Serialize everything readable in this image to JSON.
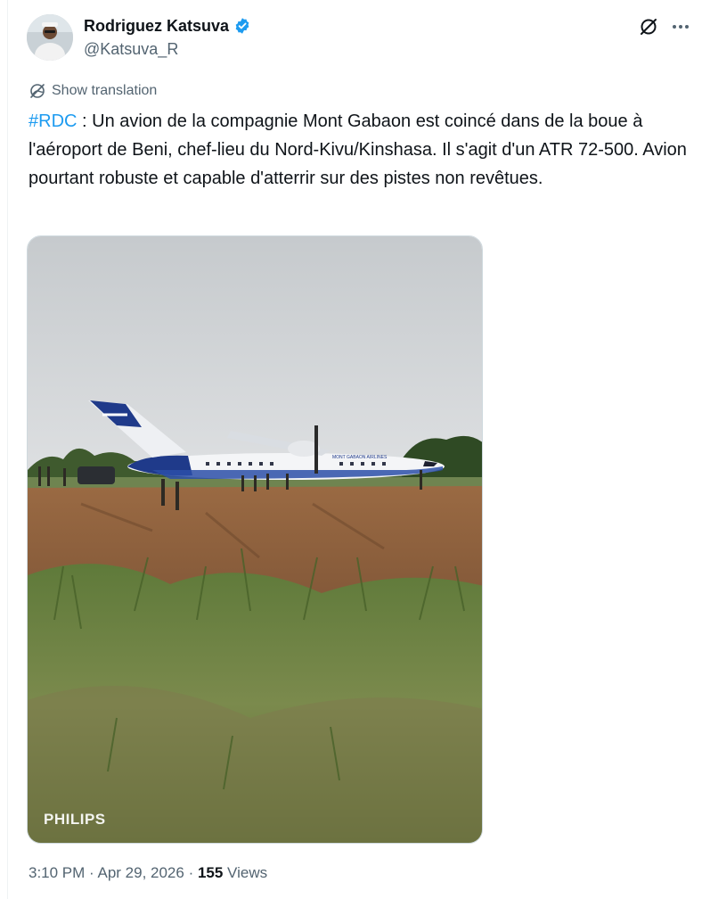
{
  "author": {
    "display_name": "Rodriguez Katsuva",
    "handle": "@Katsuva_R"
  },
  "translate_label": "Show translation",
  "tweet": {
    "hashtag": "#RDC",
    "text": " : Un avion de la compagnie Mont Gabaon est coincé dans de la boue à l'aéroport de Beni, chef-lieu du Nord-Kivu/Kinshasa. Il s'agit d'un ATR 72-500. Avion pourtant robuste et capable d'atterrir sur des pistes non revêtues."
  },
  "media": {
    "aircraft_livery": "MONT GABAON AIRLINES",
    "watermark": "PHILIPS"
  },
  "meta": {
    "time": "3:10 PM",
    "separator": " · ",
    "date": "Apr 29, 2026",
    "views_count": "155",
    "views_label": " Views"
  },
  "colors": {
    "accent": "#1d9bf0",
    "secondary_text": "#536471",
    "primary_text": "#0f1419"
  },
  "icons": {
    "verified": "verified-badge-icon",
    "grok": "grok-icon",
    "more": "more-dots-icon",
    "translate": "globe-icon"
  }
}
